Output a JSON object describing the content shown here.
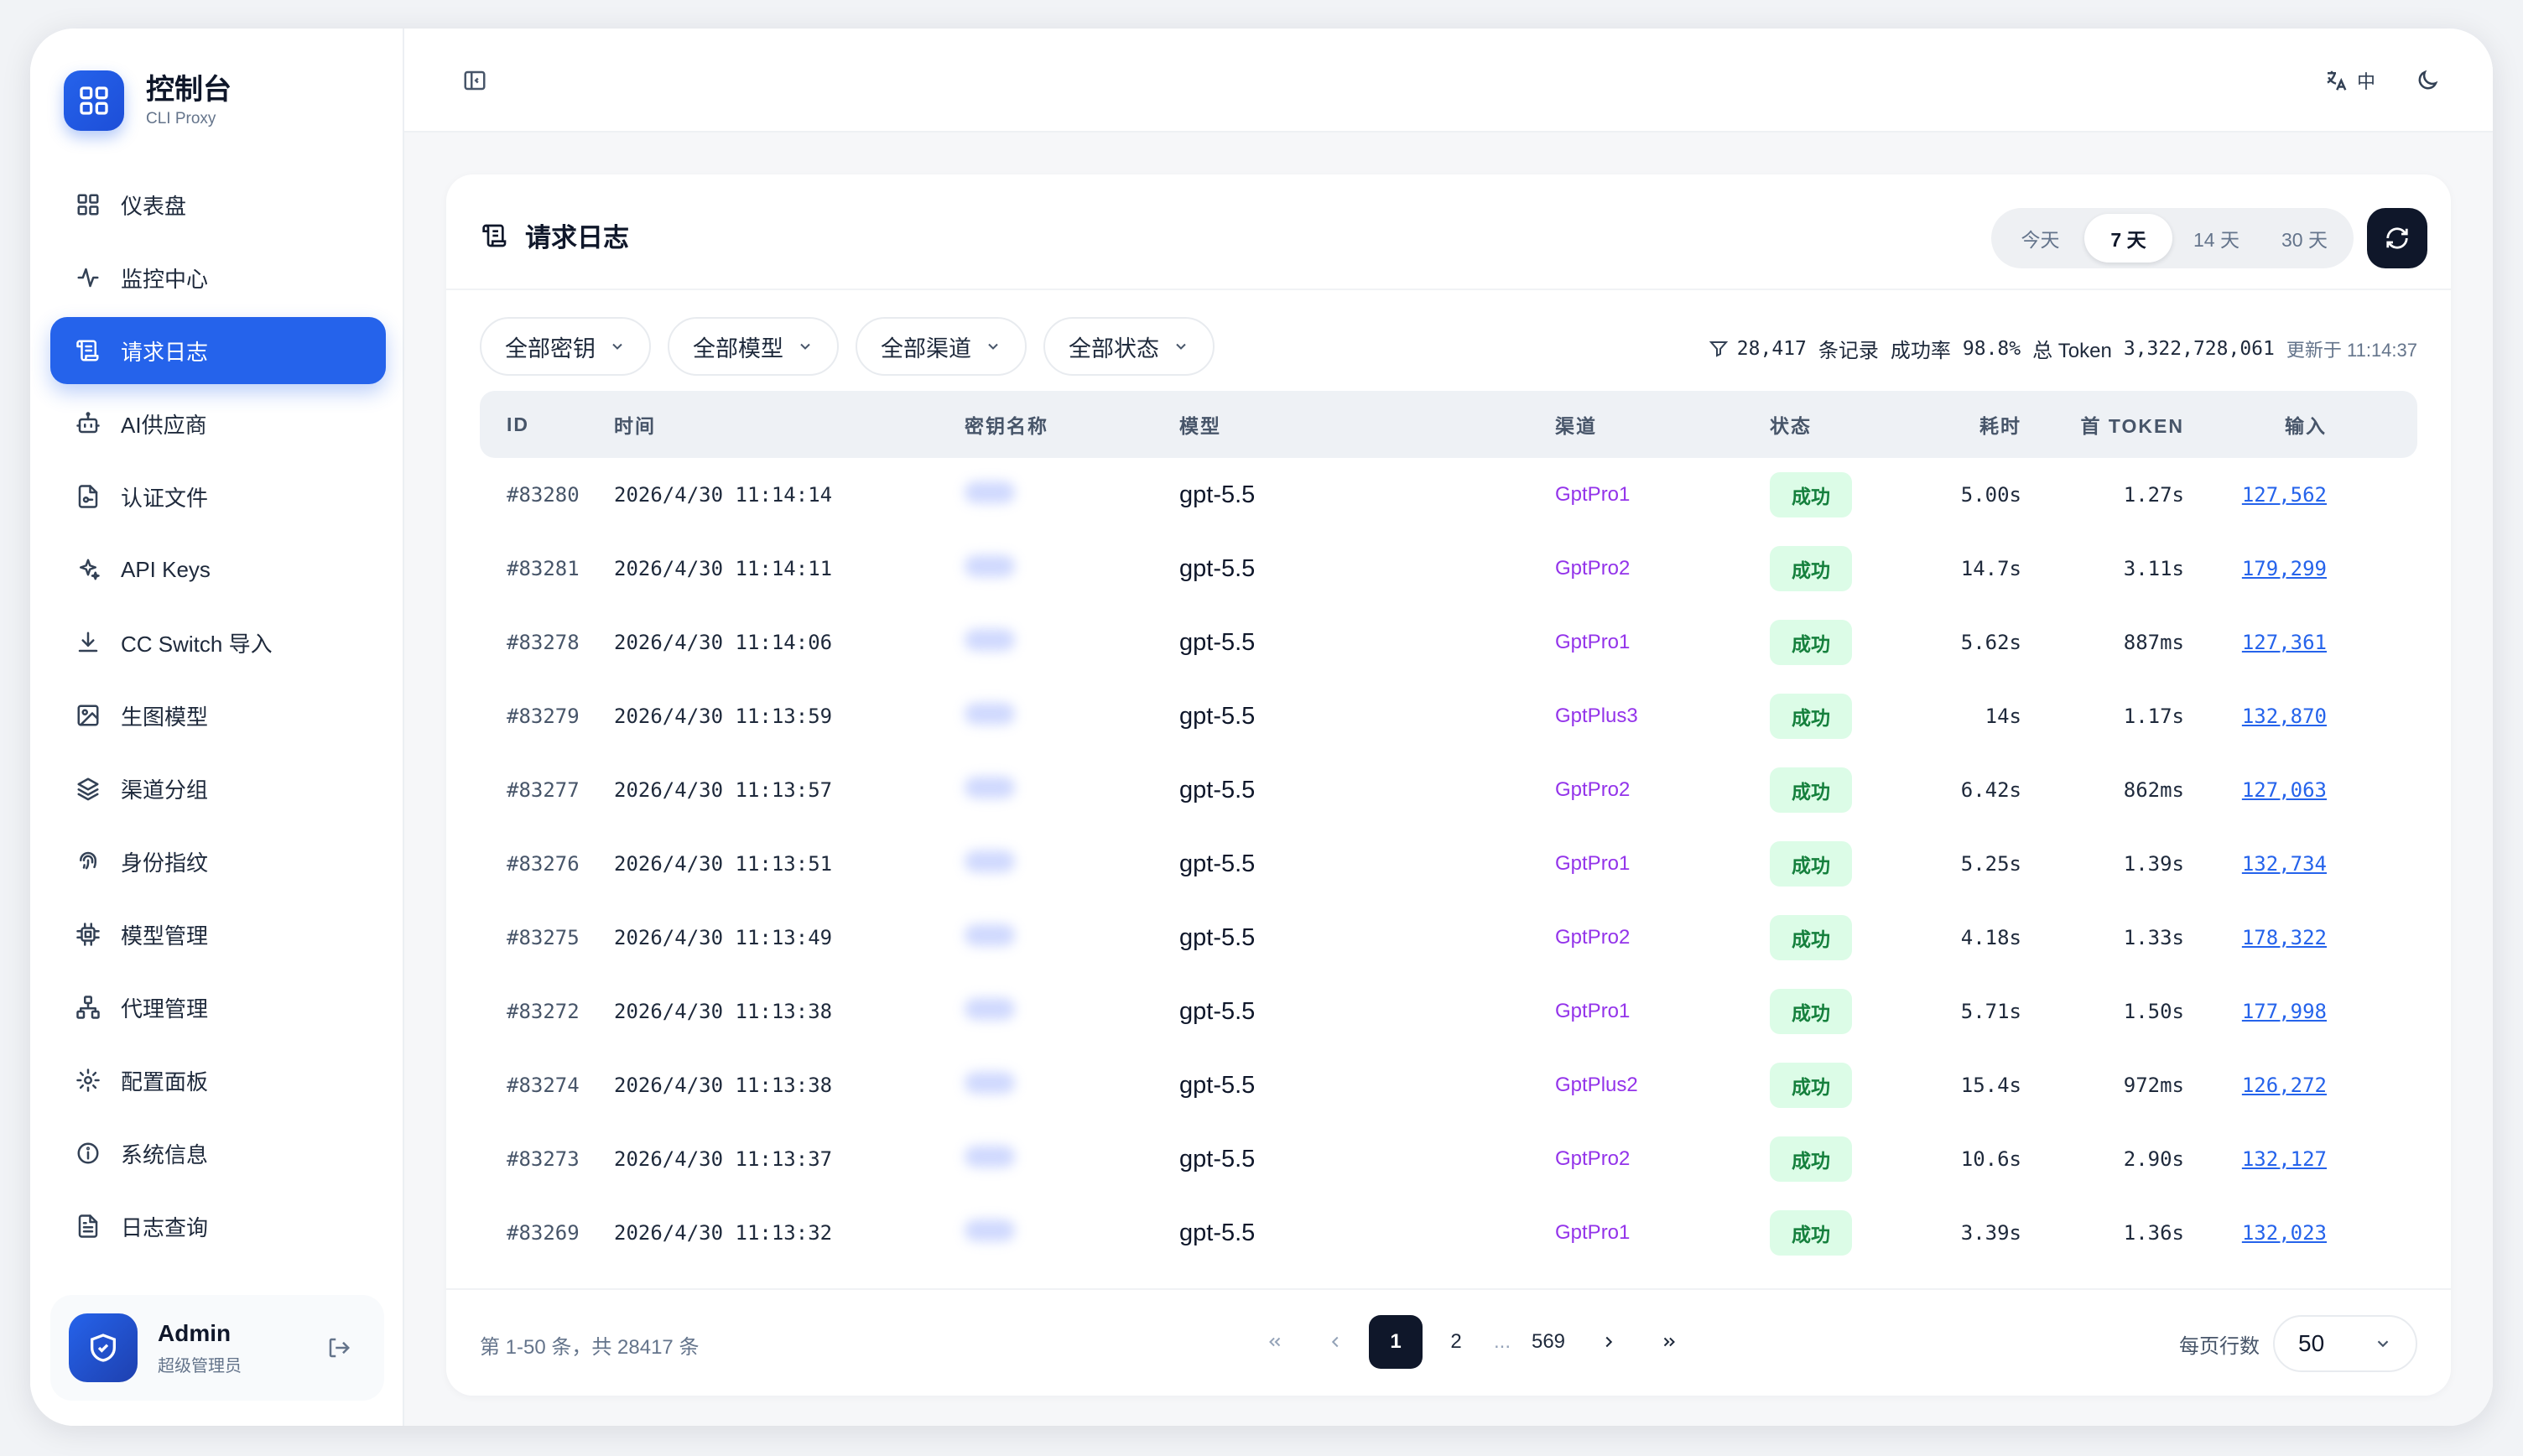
{
  "brand": {
    "title": "控制台",
    "subtitle": "CLI Proxy"
  },
  "sidebar": {
    "items": [
      {
        "label": "仪表盘",
        "icon": "grid-icon",
        "name": "sidebar-item-dashboard"
      },
      {
        "label": "监控中心",
        "icon": "activity-icon",
        "name": "sidebar-item-monitor"
      },
      {
        "label": "请求日志",
        "icon": "scroll-icon",
        "name": "sidebar-item-request-logs",
        "active": true
      },
      {
        "label": "AI供应商",
        "icon": "bot-icon",
        "name": "sidebar-item-ai-providers"
      },
      {
        "label": "认证文件",
        "icon": "file-key-icon",
        "name": "sidebar-item-auth-files"
      },
      {
        "label": "API Keys",
        "icon": "sparkles-icon",
        "name": "sidebar-item-api-keys"
      },
      {
        "label": "CC Switch 导入",
        "icon": "download-icon",
        "name": "sidebar-item-cc-switch-import"
      },
      {
        "label": "生图模型",
        "icon": "image-icon",
        "name": "sidebar-item-image-models"
      },
      {
        "label": "渠道分组",
        "icon": "layers-icon",
        "name": "sidebar-item-channel-groups"
      },
      {
        "label": "身份指纹",
        "icon": "fingerprint-icon",
        "name": "sidebar-item-fingerprint"
      },
      {
        "label": "模型管理",
        "icon": "cpu-icon",
        "name": "sidebar-item-model-management"
      },
      {
        "label": "代理管理",
        "icon": "network-icon",
        "name": "sidebar-item-proxy-management"
      },
      {
        "label": "配置面板",
        "icon": "gear-icon",
        "name": "sidebar-item-config"
      },
      {
        "label": "系统信息",
        "icon": "info-icon",
        "name": "sidebar-item-system-info"
      },
      {
        "label": "日志查询",
        "icon": "file-text-icon",
        "name": "sidebar-item-log-query"
      }
    ]
  },
  "user": {
    "name": "Admin",
    "role": "超级管理员"
  },
  "topbar": {
    "lang_label": "中"
  },
  "page": {
    "title": "请求日志"
  },
  "ranges": [
    {
      "label": "今天"
    },
    {
      "label": "7 天",
      "active": true
    },
    {
      "label": "14 天"
    },
    {
      "label": "30 天"
    }
  ],
  "filters": [
    {
      "label": "全部密钥",
      "name": "filter-key"
    },
    {
      "label": "全部模型",
      "name": "filter-model"
    },
    {
      "label": "全部渠道",
      "name": "filter-channel"
    },
    {
      "label": "全部状态",
      "name": "filter-status"
    }
  ],
  "stats": {
    "records": "28,417",
    "records_label": "条记录",
    "success_label": "成功率",
    "success_rate": "98.8%",
    "token_label": "总 Token",
    "token_total": "3,322,728,061",
    "updated": "更新于 11:14:37"
  },
  "table": {
    "headers": {
      "id": "ID",
      "time": "时间",
      "key": "密钥名称",
      "model": "模型",
      "channel": "渠道",
      "status": "状态",
      "duration": "耗时",
      "first_token": "首 TOKEN",
      "input": "输入"
    },
    "rows": [
      {
        "id": "#83280",
        "time": "2026/4/30 11:14:14",
        "model": "gpt-5.5",
        "channel": "GptPro1",
        "status": "成功",
        "duration": "5.00s",
        "first_token": "1.27s",
        "input": "127,562"
      },
      {
        "id": "#83281",
        "time": "2026/4/30 11:14:11",
        "model": "gpt-5.5",
        "channel": "GptPro2",
        "status": "成功",
        "duration": "14.7s",
        "first_token": "3.11s",
        "input": "179,299"
      },
      {
        "id": "#83278",
        "time": "2026/4/30 11:14:06",
        "model": "gpt-5.5",
        "channel": "GptPro1",
        "status": "成功",
        "duration": "5.62s",
        "first_token": "887ms",
        "input": "127,361"
      },
      {
        "id": "#83279",
        "time": "2026/4/30 11:13:59",
        "model": "gpt-5.5",
        "channel": "GptPlus3",
        "status": "成功",
        "duration": "14s",
        "first_token": "1.17s",
        "input": "132,870"
      },
      {
        "id": "#83277",
        "time": "2026/4/30 11:13:57",
        "model": "gpt-5.5",
        "channel": "GptPro2",
        "status": "成功",
        "duration": "6.42s",
        "first_token": "862ms",
        "input": "127,063"
      },
      {
        "id": "#83276",
        "time": "2026/4/30 11:13:51",
        "model": "gpt-5.5",
        "channel": "GptPro1",
        "status": "成功",
        "duration": "5.25s",
        "first_token": "1.39s",
        "input": "132,734"
      },
      {
        "id": "#83275",
        "time": "2026/4/30 11:13:49",
        "model": "gpt-5.5",
        "channel": "GptPro2",
        "status": "成功",
        "duration": "4.18s",
        "first_token": "1.33s",
        "input": "178,322"
      },
      {
        "id": "#83272",
        "time": "2026/4/30 11:13:38",
        "model": "gpt-5.5",
        "channel": "GptPro1",
        "status": "成功",
        "duration": "5.71s",
        "first_token": "1.50s",
        "input": "177,998"
      },
      {
        "id": "#83274",
        "time": "2026/4/30 11:13:38",
        "model": "gpt-5.5",
        "channel": "GptPlus2",
        "status": "成功",
        "duration": "15.4s",
        "first_token": "972ms",
        "input": "126,272"
      },
      {
        "id": "#83273",
        "time": "2026/4/30 11:13:37",
        "model": "gpt-5.5",
        "channel": "GptPro2",
        "status": "成功",
        "duration": "10.6s",
        "first_token": "2.90s",
        "input": "132,127"
      },
      {
        "id": "#83269",
        "time": "2026/4/30 11:13:32",
        "model": "gpt-5.5",
        "channel": "GptPro1",
        "status": "成功",
        "duration": "3.39s",
        "first_token": "1.36s",
        "input": "132,023"
      }
    ]
  },
  "footer": {
    "range_text": "第 1-50 条，共 28417 条",
    "pages": [
      "1",
      "2",
      "...",
      "569"
    ],
    "per_page_label": "每页行数",
    "per_page_value": "50"
  },
  "colors": {
    "accent": "#2563eb",
    "dark": "#0f172a",
    "channel": "#9333ea",
    "success_bg": "#dcfce7",
    "success_text": "#15803d"
  }
}
